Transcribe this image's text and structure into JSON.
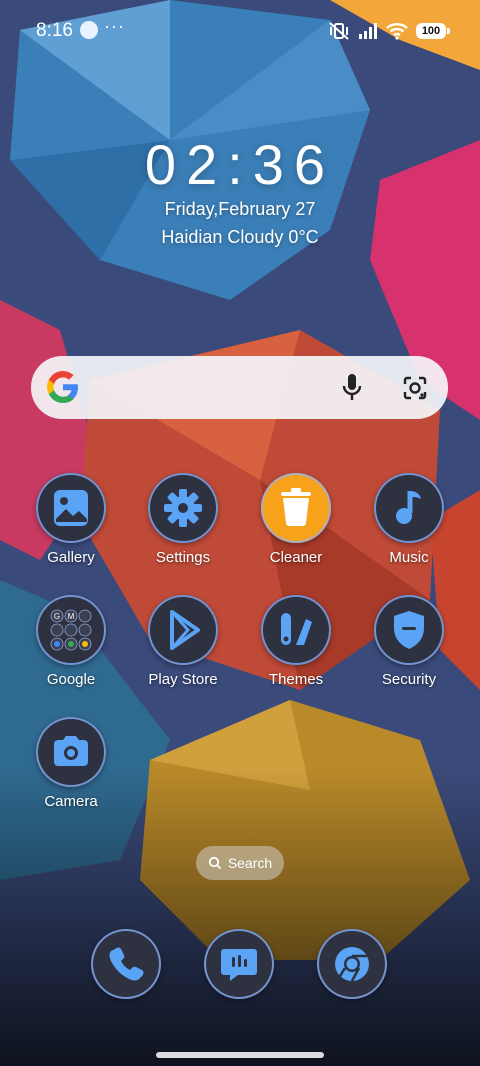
{
  "status_bar": {
    "time": "8:16",
    "dots": "···",
    "battery": "100",
    "icons": [
      "app-notification-icon",
      "vibrate-mute-icon",
      "signal-icon",
      "wifi-icon",
      "battery-icon"
    ]
  },
  "clock": {
    "time": "02:36",
    "date": "Friday,February 27",
    "weather": "Haidian Cloudy 0°C"
  },
  "search_widget": {
    "icons": [
      "google-logo-icon",
      "microphone-icon",
      "google-lens-icon"
    ]
  },
  "apps": [
    {
      "label": "Gallery",
      "icon": "gallery-icon"
    },
    {
      "label": "Settings",
      "icon": "gear-icon"
    },
    {
      "label": "Cleaner",
      "icon": "trash-icon"
    },
    {
      "label": "Music",
      "icon": "music-note-icon"
    },
    {
      "label": "Google",
      "icon": "google-folder-icon"
    },
    {
      "label": "Play Store",
      "icon": "play-store-icon"
    },
    {
      "label": "Themes",
      "icon": "themes-icon"
    },
    {
      "label": "Security",
      "icon": "shield-icon"
    },
    {
      "label": "Camera",
      "icon": "camera-icon"
    }
  ],
  "app_search": {
    "label": "Search",
    "icon": "search-icon"
  },
  "dock": [
    {
      "icon": "phone-icon"
    },
    {
      "icon": "messages-icon"
    },
    {
      "icon": "chrome-icon"
    }
  ],
  "colors": {
    "accent_blue": "#5aa3f5",
    "cleaner_orange": "#f7a21a",
    "icon_bg": "#2d3140"
  }
}
